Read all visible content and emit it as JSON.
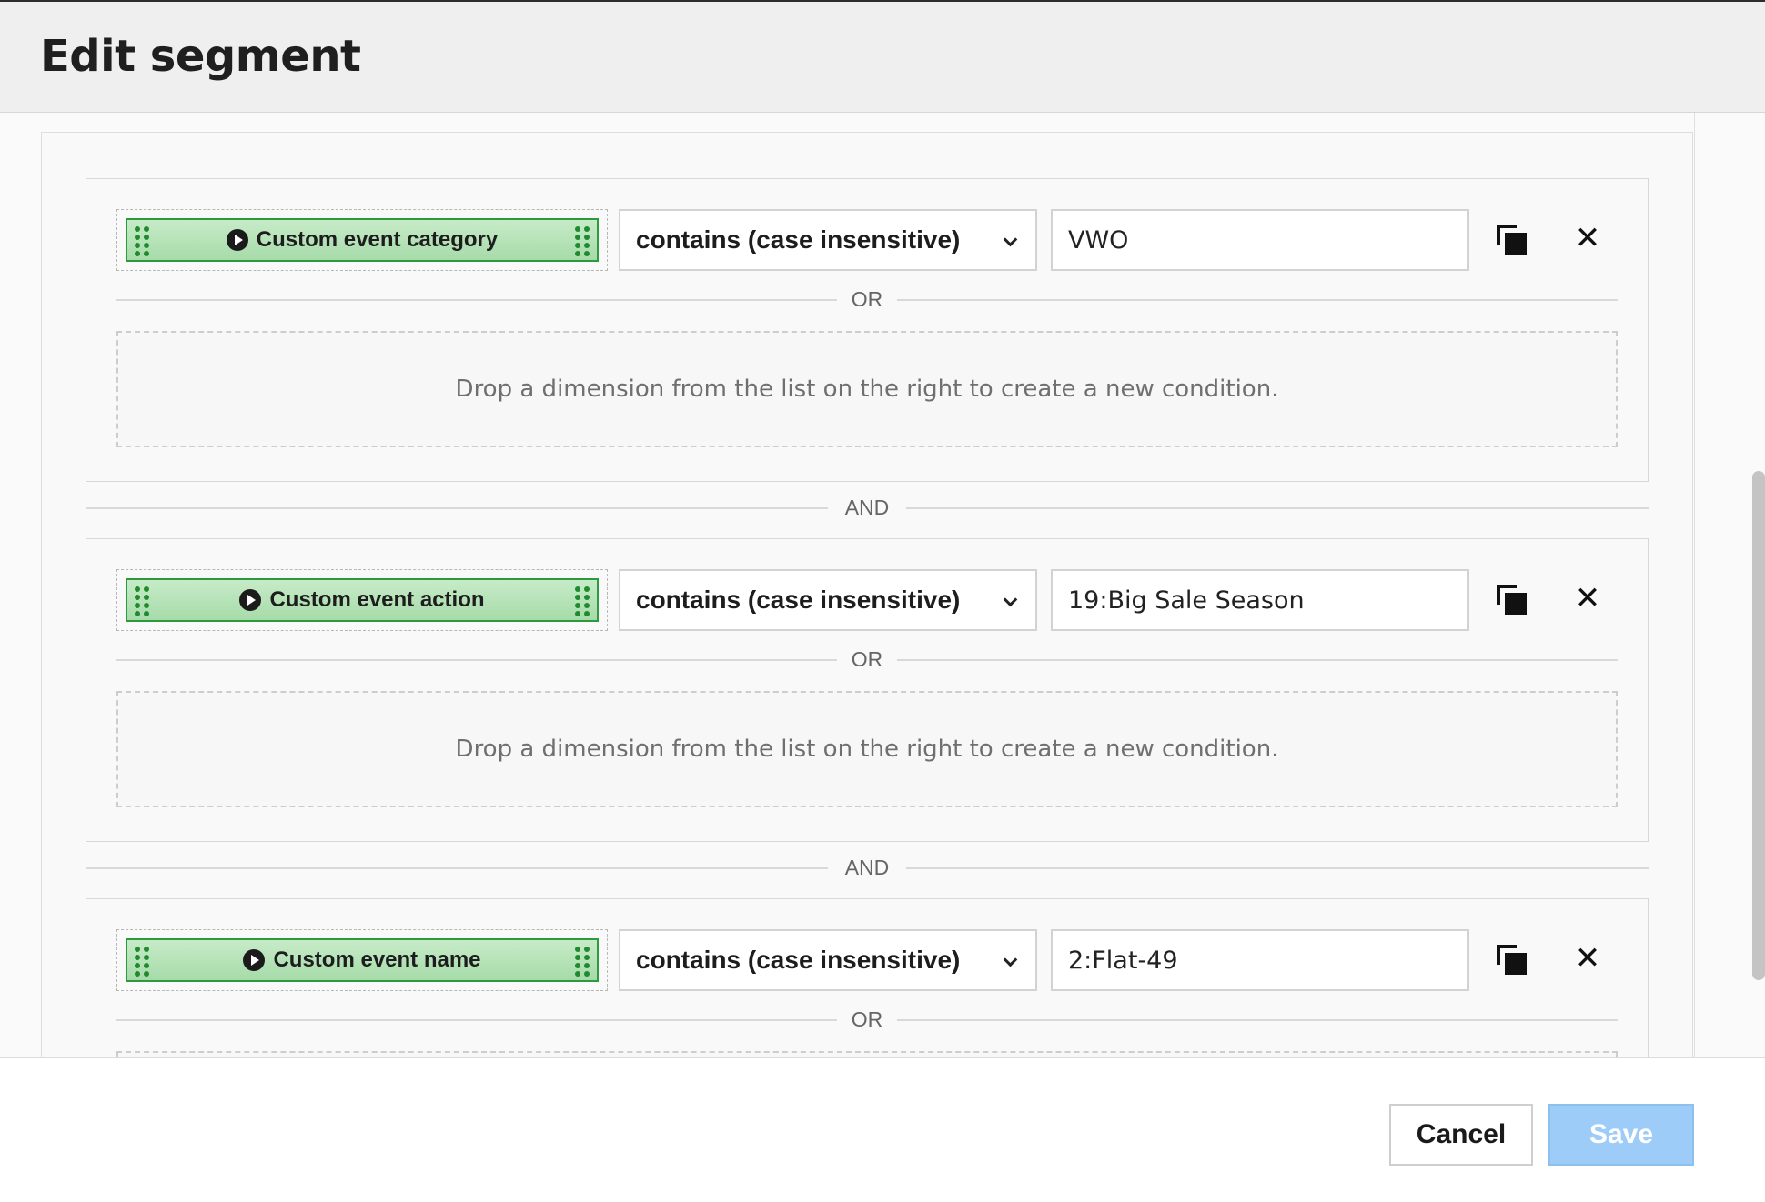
{
  "dialog": {
    "title": "Edit segment"
  },
  "groups": [
    {
      "dimension": "Custom event category",
      "operator": "contains (case insensitive)",
      "value": "VWO",
      "or_label": "OR",
      "dropzone_text": "Drop a dimension from the list on the right to create a new condition."
    },
    {
      "dimension": "Custom event action",
      "operator": "contains (case insensitive)",
      "value": "19:Big Sale Season",
      "or_label": "OR",
      "dropzone_text": "Drop a dimension from the list on the right to create a new condition."
    },
    {
      "dimension": "Custom event name",
      "operator": "contains (case insensitive)",
      "value": "2:Flat-49",
      "or_label": "OR"
    }
  ],
  "and_label": "AND",
  "icons": {
    "dimension": "play-circle-icon",
    "drag": "drag-handle-icon",
    "copy": "copy-icon",
    "remove": "close-icon",
    "dropdown": "chevron-down-icon"
  },
  "footer": {
    "cancel_label": "Cancel",
    "save_label": "Save"
  },
  "colors": {
    "chip_border": "#2e9a3e",
    "chip_fill": "#b3e2b5",
    "save_button": "#9cccf7"
  }
}
